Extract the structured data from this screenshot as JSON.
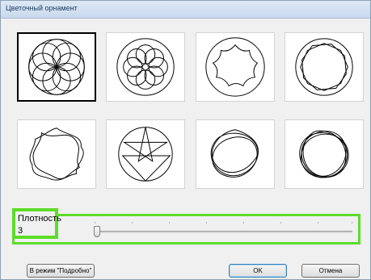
{
  "window": {
    "title": "Цветочный орнамент"
  },
  "patterns": [
    {
      "name": "rose-circles",
      "selected": true
    },
    {
      "name": "loop-flower"
    },
    {
      "name": "scalloped-flower"
    },
    {
      "name": "octagon-star"
    },
    {
      "name": "wave-star"
    },
    {
      "name": "spike-star"
    },
    {
      "name": "loop-star"
    },
    {
      "name": "dense-loop-star"
    }
  ],
  "density": {
    "label": "Плотность",
    "value": "3"
  },
  "buttons": {
    "detail_mode": "В режим \"Подробно\"",
    "ok": "OK",
    "cancel": "Отмена"
  }
}
